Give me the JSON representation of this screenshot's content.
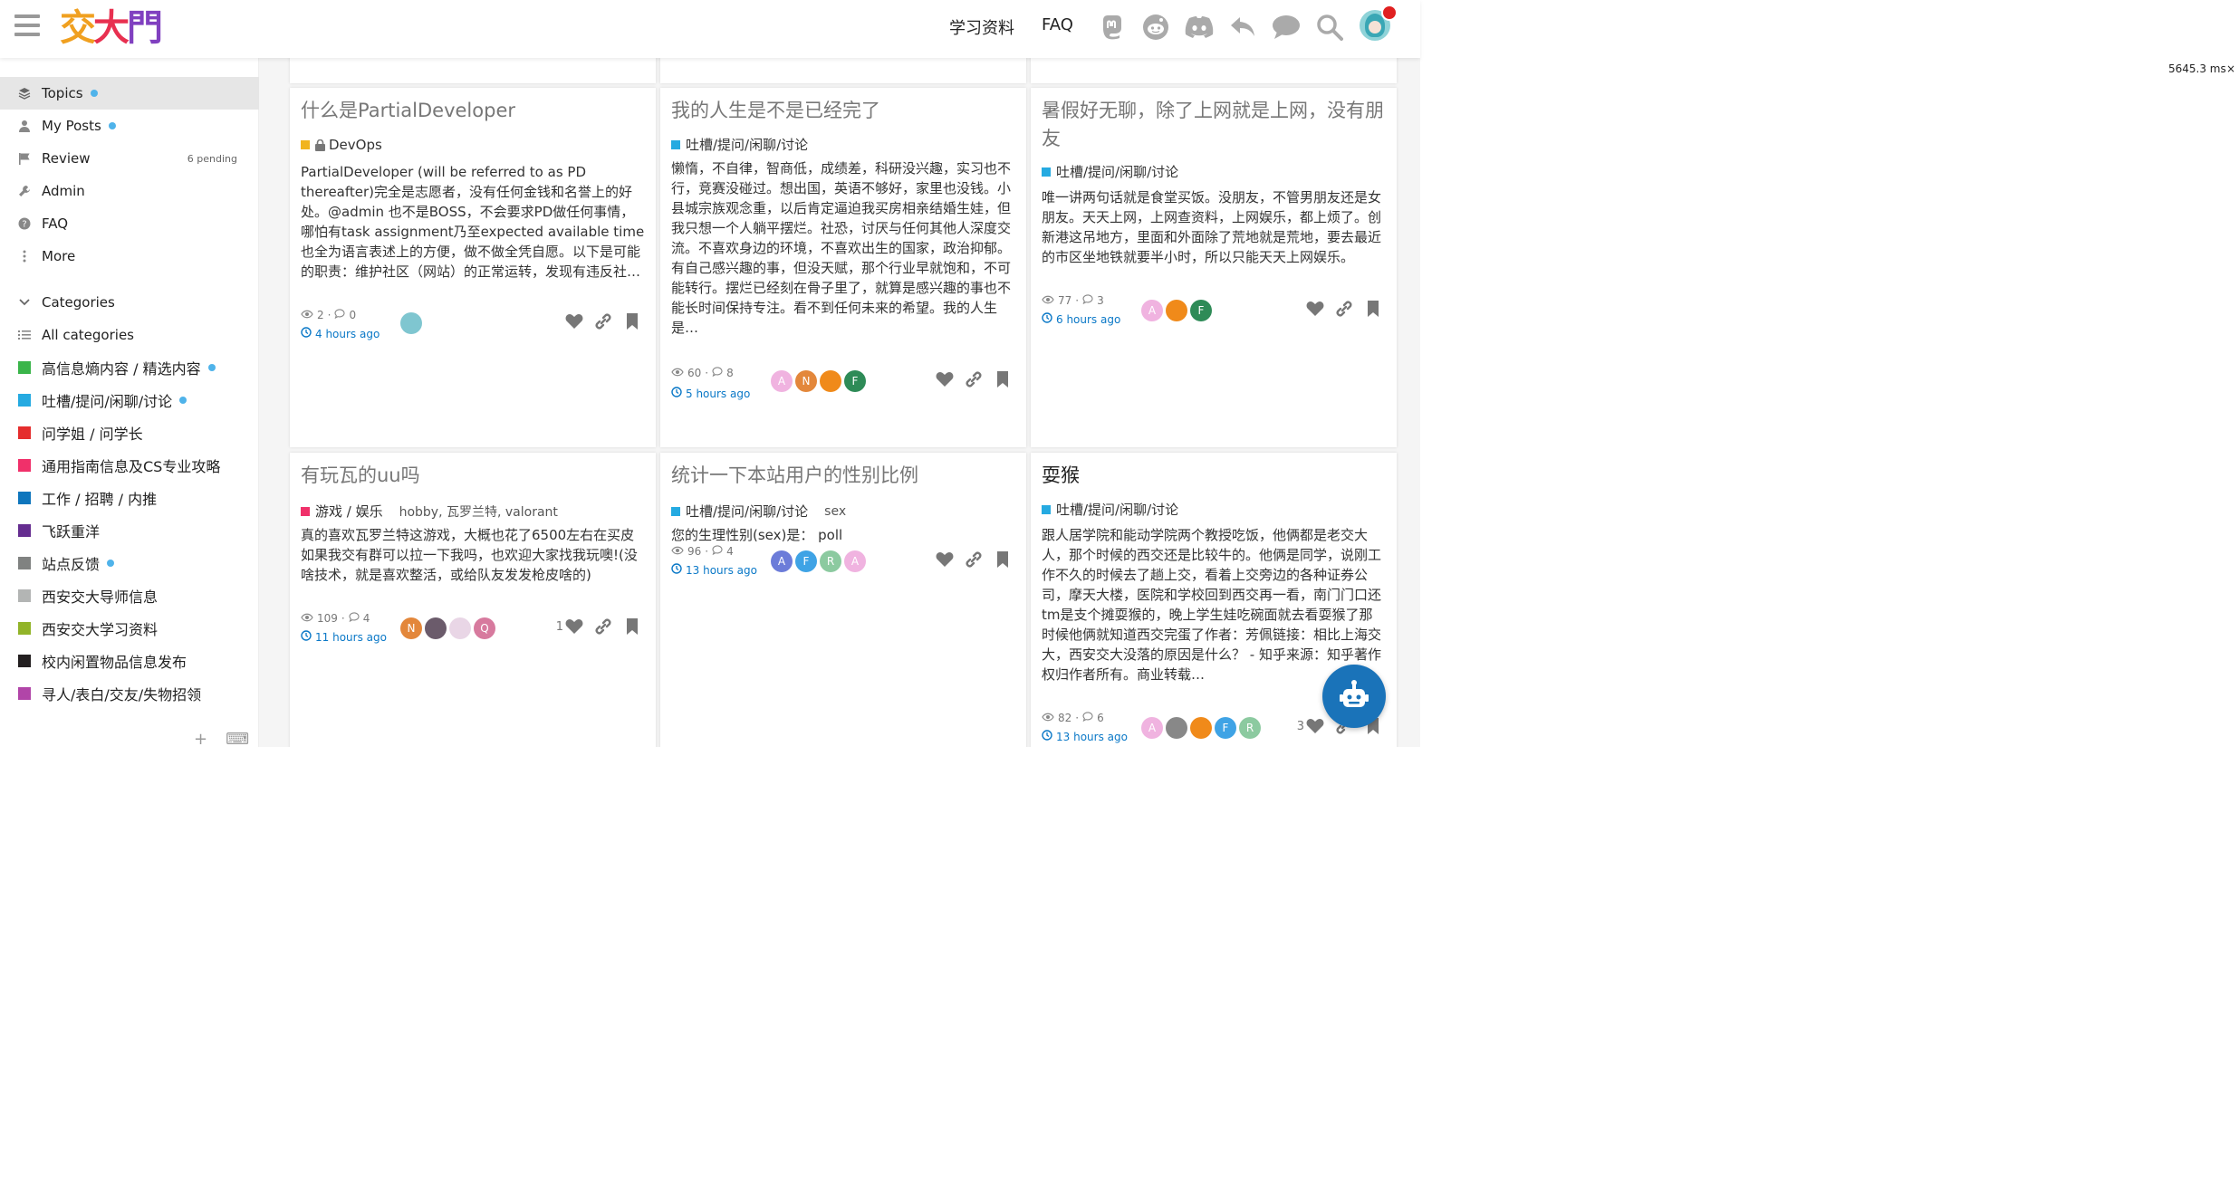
{
  "header": {
    "logo_chars": [
      "交",
      "大",
      "門"
    ],
    "logo_colors": [
      "#f0a020",
      "#e83050",
      "#8040c0"
    ],
    "nav": [
      "学习资料",
      "FAQ"
    ],
    "icons": [
      "mastodon-icon",
      "reddit-icon",
      "discord-icon",
      "reply-icon",
      "chat-icon",
      "search-icon",
      "avatar"
    ],
    "timer": "5645.3 ms",
    "timer_close": "×"
  },
  "sidebar": {
    "items": [
      {
        "label": "Topics",
        "icon": "layers-icon",
        "dot": true,
        "active": true
      },
      {
        "label": "My Posts",
        "icon": "user-icon",
        "dot": true
      },
      {
        "label": "Review",
        "icon": "flag-icon",
        "badge": "6 pending"
      },
      {
        "label": "Admin",
        "icon": "wrench-icon"
      },
      {
        "label": "FAQ",
        "icon": "question-icon"
      },
      {
        "label": "More",
        "icon": "ellipsis-icon"
      }
    ],
    "categories_heading": "Categories",
    "all_categories": "All categories",
    "categories": [
      {
        "label": "高信息熵内容 / 精选内容",
        "color": "#3ab54a",
        "dot": true
      },
      {
        "label": "吐槽/提问/闲聊/讨论",
        "color": "#25aae1",
        "dot": true
      },
      {
        "label": "问学姐 / 问学长",
        "color": "#e52d2d"
      },
      {
        "label": "通用指南信息及CS专业攻略",
        "color": "#f0306a"
      },
      {
        "label": "工作 / 招聘 / 内推",
        "color": "#0e76bd"
      },
      {
        "label": "飞跃重洋",
        "color": "#652d90"
      },
      {
        "label": "站点反馈",
        "color": "#808281",
        "dot": true
      },
      {
        "label": "西安交大导师信息",
        "color": "#b3b5b4"
      },
      {
        "label": "西安交大学习资料",
        "color": "#92b429"
      },
      {
        "label": "校内闲置物品信息发布",
        "color": "#231f20"
      },
      {
        "label": "寻人/表白/交友/失物招领",
        "color": "#b145a8"
      }
    ],
    "footer_plus": "+",
    "footer_keyboard": "⌨"
  },
  "cards": [
    {
      "title": "什么是PartialDeveloper",
      "title_dark": false,
      "category": "DevOps",
      "cat_color": "#f1b41e",
      "locked": true,
      "tags": "",
      "excerpt": "PartialDeveloper (will be referred to as PD thereafter)完全是志愿者，没有任何金钱和名誉上的好处。@admin 也不是BOSS，不会要求PD做任何事情，哪怕有task assignment乃至expected available time也全为语言表述上的方便，做不做全凭自愿。以下是可能的职责：维护社区（网站）的正常运转，发现有违反社…",
      "views": "2",
      "replies": "0",
      "time": "4 hours ago",
      "avatars": [
        {
          "t": "",
          "c": "#7fc6d0"
        }
      ],
      "likes": ""
    },
    {
      "title": "我的人生是不是已经完了",
      "title_dark": false,
      "category": "吐槽/提问/闲聊/讨论",
      "cat_color": "#25aae1",
      "locked": false,
      "tags": "",
      "excerpt": "懒惰，不自律，智商低，成绩差，科研没兴趣，实习也不行，竞赛没碰过。想出国，英语不够好，家里也没钱。小县城宗族观念重，以后肯定逼迫我买房相亲结婚生娃，但我只想一个人躺平摆烂。社恐，讨厌与任何其他人深度交流。不喜欢身边的环境，不喜欢出生的国家，政治抑郁。有自己感兴趣的事，但没天赋，那个行业早就饱和，不可能转行。摆烂已经刻在骨子里了，就算是感兴趣的事也不能长时间保持专注。看不到任何未来的希望。我的人生是…",
      "views": "60",
      "replies": "8",
      "time": "5 hours ago",
      "avatars": [
        {
          "t": "A",
          "c": "#f0b3e0"
        },
        {
          "t": "N",
          "c": "#e3873b"
        },
        {
          "t": "",
          "c": "#f08a1a"
        },
        {
          "t": "F",
          "c": "#2e8b57"
        }
      ],
      "likes": ""
    },
    {
      "title": "暑假好无聊，除了上网就是上网，没有朋友",
      "title_dark": false,
      "category": "吐槽/提问/闲聊/讨论",
      "cat_color": "#25aae1",
      "locked": false,
      "tags": "",
      "excerpt": "唯一讲两句话就是食堂买饭。没朋友，不管男朋友还是女朋友。天天上网，上网查资料，上网娱乐，都上烦了。创新港这吊地方，里面和外面除了荒地就是荒地，要去最近的市区坐地铁就要半小时，所以只能天天上网娱乐。",
      "views": "77",
      "replies": "3",
      "time": "6 hours ago",
      "avatars": [
        {
          "t": "A",
          "c": "#f0b3e0"
        },
        {
          "t": "",
          "c": "#f08a1a"
        },
        {
          "t": "F",
          "c": "#2e8b57"
        }
      ],
      "likes": ""
    },
    {
      "title": "有玩瓦的uu吗",
      "title_dark": false,
      "category": "游戏 / 娱乐",
      "cat_color": "#f0306a",
      "locked": false,
      "tags": "hobby, 瓦罗兰特, valorant",
      "excerpt": "真的喜欢瓦罗兰特这游戏，大概也花了6500左右在买皮如果我交有群可以拉一下我吗，也欢迎大家找我玩噢!(没啥技术，就是喜欢整活，或给队友发发枪皮啥的)",
      "views": "109",
      "replies": "4",
      "time": "11 hours ago",
      "avatars": [
        {
          "t": "N",
          "c": "#e3873b"
        },
        {
          "t": "",
          "c": "#6b5b6b"
        },
        {
          "t": "",
          "c": "#e9d6e6"
        },
        {
          "t": "Q",
          "c": "#d77a9e"
        }
      ],
      "likes": "1"
    },
    {
      "title": "统计一下本站用户的性别比例",
      "title_dark": false,
      "category": "吐槽/提问/闲聊/讨论",
      "cat_color": "#25aae1",
      "locked": false,
      "tags": "sex",
      "excerpt": "您的生理性别(sex)是：  poll",
      "views": "96",
      "replies": "4",
      "time": "13 hours ago",
      "avatars": [
        {
          "t": "A",
          "c": "#6c7cd9"
        },
        {
          "t": "F",
          "c": "#3fa3e5"
        },
        {
          "t": "R",
          "c": "#8ccaa0"
        },
        {
          "t": "A",
          "c": "#f0b3e0"
        }
      ],
      "likes": ""
    },
    {
      "title": "耍猴",
      "title_dark": true,
      "category": "吐槽/提问/闲聊/讨论",
      "cat_color": "#25aae1",
      "locked": false,
      "tags": "",
      "excerpt": "跟人居学院和能动学院两个教授吃饭，他俩都是老交大人，那个时候的西交还是比较牛的。他俩是同学，说刚工作不久的时候去了趟上交，看着上交旁边的各种证券公司，摩天大楼，医院和学校回到西交再一看，南门门口还tm是支个摊耍猴的，晚上学生娃吃碗面就去看耍猴了那时候他俩就知道西交完蛋了作者：芳佩链接：相比上海交大，西安交大没落的原因是什么？ - 知乎来源：知乎著作权归作者所有。商业转载…",
      "views": "82",
      "replies": "6",
      "time": "13 hours ago",
      "avatars": [
        {
          "t": "A",
          "c": "#f0b3e0"
        },
        {
          "t": "",
          "c": "#888"
        },
        {
          "t": "",
          "c": "#f08a1a"
        },
        {
          "t": "F",
          "c": "#3fa3e5"
        },
        {
          "t": "R",
          "c": "#8ccaa0"
        }
      ],
      "likes": "3"
    }
  ]
}
